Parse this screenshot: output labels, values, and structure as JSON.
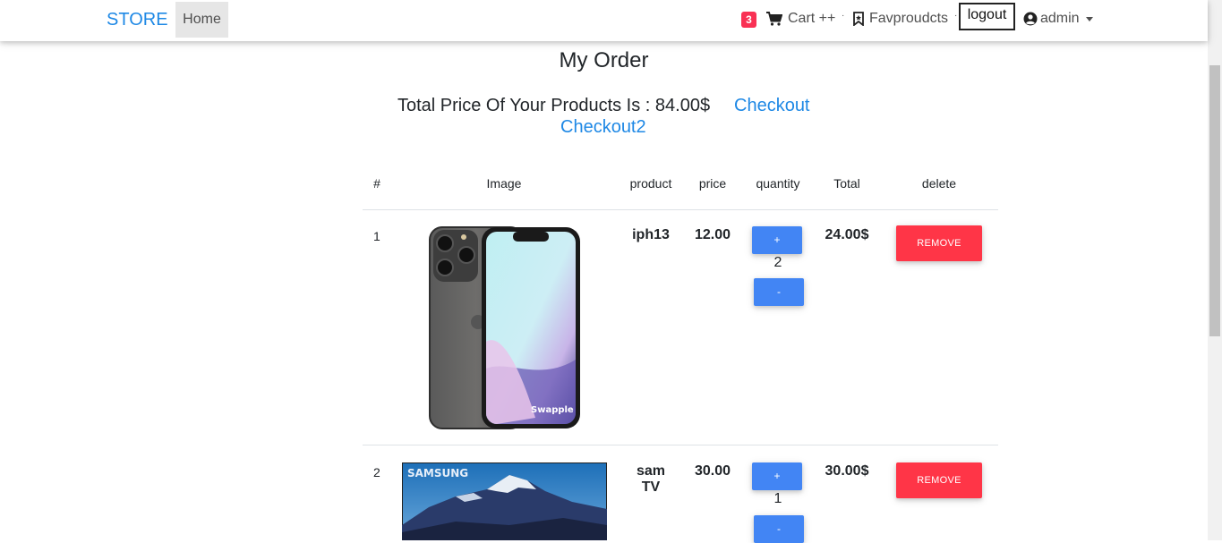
{
  "nav": {
    "brand": "STORE",
    "home": "Home",
    "cart_count": "3",
    "cart_label": "Cart ++",
    "fav_label": "Favproudcts",
    "logout": "logout",
    "user": "admin",
    "sep1": "·",
    "sep2": "·"
  },
  "page": {
    "title": "My Order",
    "total_text": "Total Price Of Your Products Is : 84.00$",
    "checkout": "Checkout",
    "checkout2": "Checkout2"
  },
  "table": {
    "headers": [
      "#",
      "Image",
      "product",
      "price",
      "quantity",
      "Total",
      "delete"
    ],
    "rows": [
      {
        "index": "1",
        "product": "iph13",
        "price": "12.00",
        "quantity": "2",
        "total": "24.00$",
        "plus": "+",
        "minus": "-",
        "remove": "REMOVE",
        "image_text": "Swapple"
      },
      {
        "index": "2",
        "product": "sam TV",
        "price": "30.00",
        "quantity": "1",
        "total": "30.00$",
        "plus": "+",
        "minus": "-",
        "remove": "REMOVE",
        "image_text": "SAMSUNG"
      }
    ]
  },
  "colors": {
    "accent": "#1e88e5",
    "badge": "#f93154",
    "qty_button": "#4285f4",
    "remove_button": "#ff3547"
  },
  "icons": [
    "shopping-cart-icon",
    "bookmark-icon",
    "user-circle-icon",
    "caret-down-icon"
  ]
}
